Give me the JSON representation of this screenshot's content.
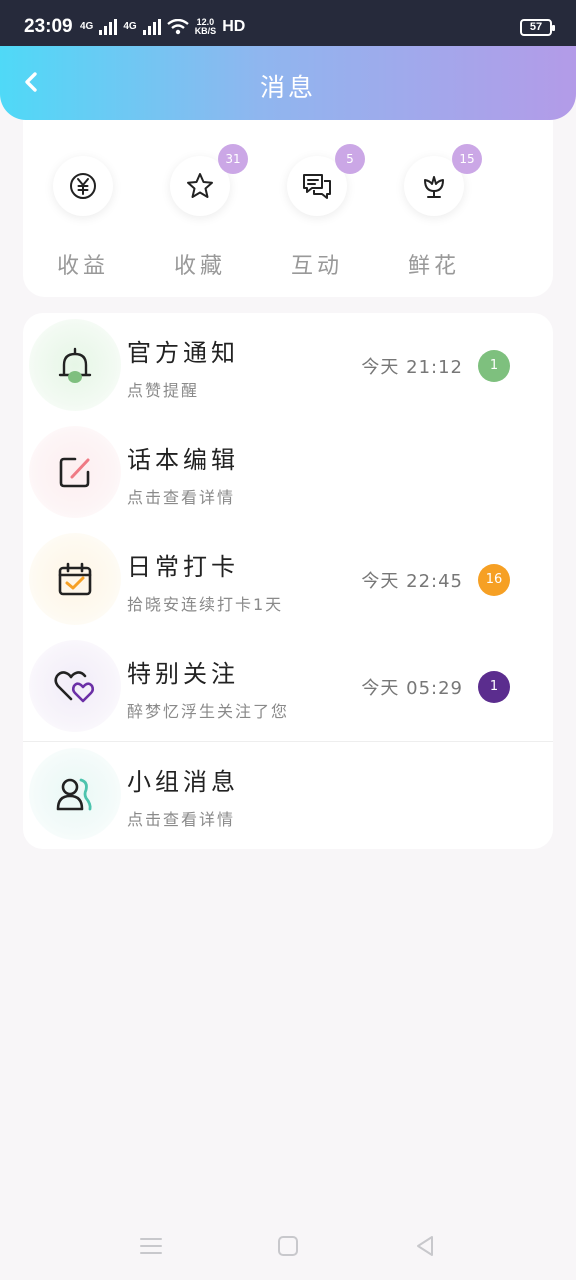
{
  "status_bar": {
    "time": "23:09",
    "net1": "4G",
    "net2": "4G",
    "speed_top": "12.0",
    "speed_bottom": "KB/S",
    "hd": "HD",
    "battery": "57"
  },
  "header": {
    "title": "消息",
    "back_icon": "chevron-left-icon"
  },
  "quick_actions": [
    {
      "label": "收益",
      "icon": "yuan-coin-icon",
      "badge": ""
    },
    {
      "label": "收藏",
      "icon": "star-icon",
      "badge": "31"
    },
    {
      "label": "互动",
      "icon": "chat-bubbles-icon",
      "badge": "5"
    },
    {
      "label": "鲜花",
      "icon": "flower-icon",
      "badge": "15"
    }
  ],
  "messages": [
    {
      "title": "官方通知",
      "subtitle": "点赞提醒",
      "time": "今天 21:12",
      "badge": "1",
      "badge_color": "#7ec07e",
      "icon": "bell-icon"
    },
    {
      "title": "话本编辑",
      "subtitle": "点击查看详情",
      "time": "",
      "badge": "",
      "icon": "edit-icon"
    },
    {
      "title": "日常打卡",
      "subtitle": "拾晓安连续打卡1天",
      "time": "今天 22:45",
      "badge": "16",
      "badge_color": "#f6a024",
      "icon": "calendar-check-icon"
    },
    {
      "title": "特别关注",
      "subtitle": "醉梦忆浮生关注了您",
      "time": "今天 05:29",
      "badge": "1",
      "badge_color": "#5b2d8e",
      "icon": "hearts-icon"
    },
    {
      "title": "小组消息",
      "subtitle": "点击查看详情",
      "time": "",
      "badge": "",
      "icon": "group-icon"
    }
  ],
  "colors": {
    "header_start": "#4fd9f7",
    "header_end": "#b39be8",
    "badge_purple": "#cba7e6"
  }
}
